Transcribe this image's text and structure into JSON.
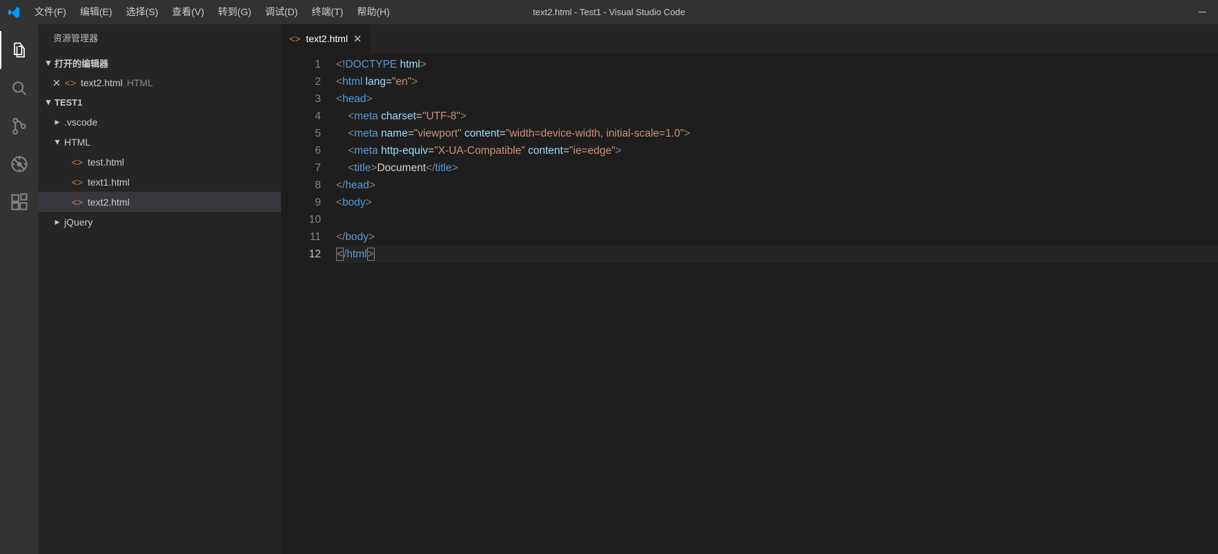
{
  "titlebar": {
    "menus": [
      "文件(F)",
      "编辑(E)",
      "选择(S)",
      "查看(V)",
      "转到(G)",
      "调试(D)",
      "终端(T)",
      "帮助(H)"
    ],
    "title": "text2.html - Test1 - Visual Studio Code"
  },
  "sidebar": {
    "title": "资源管理器",
    "openEditors": {
      "label": "打开的编辑器",
      "items": [
        {
          "name": "text2.html",
          "desc": "HTML"
        }
      ]
    },
    "workspace": {
      "label": "TEST1",
      "tree": [
        {
          "type": "folder",
          "name": ".vscode",
          "expanded": false,
          "depth": 0
        },
        {
          "type": "folder",
          "name": "HTML",
          "expanded": true,
          "depth": 0
        },
        {
          "type": "file",
          "name": "test.html",
          "depth": 1
        },
        {
          "type": "file",
          "name": "text1.html",
          "depth": 1
        },
        {
          "type": "file",
          "name": "text2.html",
          "depth": 1,
          "selected": true
        },
        {
          "type": "folder",
          "name": "jQuery",
          "expanded": false,
          "depth": 0
        }
      ]
    }
  },
  "editor": {
    "tab": {
      "name": "text2.html"
    },
    "currentLine": 12,
    "lines": [
      {
        "n": 1,
        "tokens": [
          [
            "<!",
            "bracket"
          ],
          [
            "DOCTYPE ",
            "doctype"
          ],
          [
            "html",
            "attr"
          ],
          [
            ">",
            "bracket"
          ]
        ]
      },
      {
        "n": 2,
        "tokens": [
          [
            "<",
            "bracket"
          ],
          [
            "html ",
            "tag"
          ],
          [
            "lang",
            "attr"
          ],
          [
            "=",
            "text"
          ],
          [
            "\"en\"",
            "str"
          ],
          [
            ">",
            "bracket"
          ]
        ]
      },
      {
        "n": 3,
        "tokens": [
          [
            "<",
            "bracket"
          ],
          [
            "head",
            "tag"
          ],
          [
            ">",
            "bracket"
          ]
        ]
      },
      {
        "n": 4,
        "indent": 1,
        "tokens": [
          [
            "<",
            "bracket"
          ],
          [
            "meta ",
            "tag"
          ],
          [
            "charset",
            "attr"
          ],
          [
            "=",
            "text"
          ],
          [
            "\"UTF-8\"",
            "str"
          ],
          [
            ">",
            "bracket"
          ]
        ]
      },
      {
        "n": 5,
        "indent": 1,
        "tokens": [
          [
            "<",
            "bracket"
          ],
          [
            "meta ",
            "tag"
          ],
          [
            "name",
            "attr"
          ],
          [
            "=",
            "text"
          ],
          [
            "\"viewport\" ",
            "str"
          ],
          [
            "content",
            "attr"
          ],
          [
            "=",
            "text"
          ],
          [
            "\"width=device-width, initial-scale=1.0\"",
            "str"
          ],
          [
            ">",
            "bracket"
          ]
        ]
      },
      {
        "n": 6,
        "indent": 1,
        "tokens": [
          [
            "<",
            "bracket"
          ],
          [
            "meta ",
            "tag"
          ],
          [
            "http-equiv",
            "attr"
          ],
          [
            "=",
            "text"
          ],
          [
            "\"X-UA-Compatible\" ",
            "str"
          ],
          [
            "content",
            "attr"
          ],
          [
            "=",
            "text"
          ],
          [
            "\"ie=edge\"",
            "str"
          ],
          [
            ">",
            "bracket"
          ]
        ]
      },
      {
        "n": 7,
        "indent": 1,
        "tokens": [
          [
            "<",
            "bracket"
          ],
          [
            "title",
            "tag"
          ],
          [
            ">",
            "bracket"
          ],
          [
            "Document",
            "text"
          ],
          [
            "</",
            "bracket"
          ],
          [
            "title",
            "tag"
          ],
          [
            ">",
            "bracket"
          ]
        ]
      },
      {
        "n": 8,
        "tokens": [
          [
            "</",
            "bracket"
          ],
          [
            "head",
            "tag"
          ],
          [
            ">",
            "bracket"
          ]
        ]
      },
      {
        "n": 9,
        "tokens": [
          [
            "<",
            "bracket"
          ],
          [
            "body",
            "tag"
          ],
          [
            ">",
            "bracket"
          ]
        ]
      },
      {
        "n": 10,
        "tokens": []
      },
      {
        "n": 11,
        "tokens": [
          [
            "</",
            "bracket"
          ],
          [
            "body",
            "tag"
          ],
          [
            ">",
            "bracket"
          ]
        ]
      },
      {
        "n": 12,
        "cursor": true,
        "tokens": [
          [
            "<",
            "bracketBox"
          ],
          [
            "/",
            "bracket"
          ],
          [
            "html",
            "tag"
          ],
          [
            ">",
            "bracketBox"
          ]
        ]
      }
    ]
  }
}
